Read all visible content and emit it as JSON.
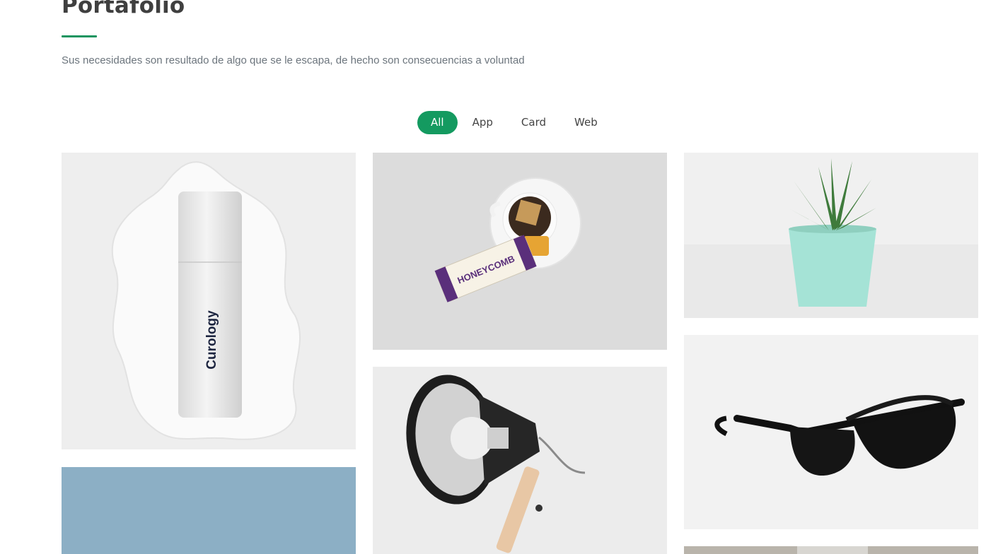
{
  "section": {
    "title": "Portafolio",
    "subtitle": "Sus necesidades son resultado de algo que se le escapa, de hecho son consecuencias a voluntad",
    "accent_color": "#16955f"
  },
  "filters": [
    {
      "label": "All",
      "active": true
    },
    {
      "label": "App",
      "active": false
    },
    {
      "label": "Card",
      "active": false
    },
    {
      "label": "Web",
      "active": false
    }
  ],
  "portfolio": {
    "items": [
      {
        "image": "cream-bottle",
        "brand_text": "Curology"
      },
      {
        "image": "tea-cup-honeycomb",
        "brand_text": "HONEYCOMB"
      },
      {
        "image": "potted-succulent"
      },
      {
        "image": "blue-backdrop"
      },
      {
        "image": "desk-lamp"
      },
      {
        "image": "black-sunglasses"
      },
      {
        "image": "partial-photo"
      }
    ]
  }
}
